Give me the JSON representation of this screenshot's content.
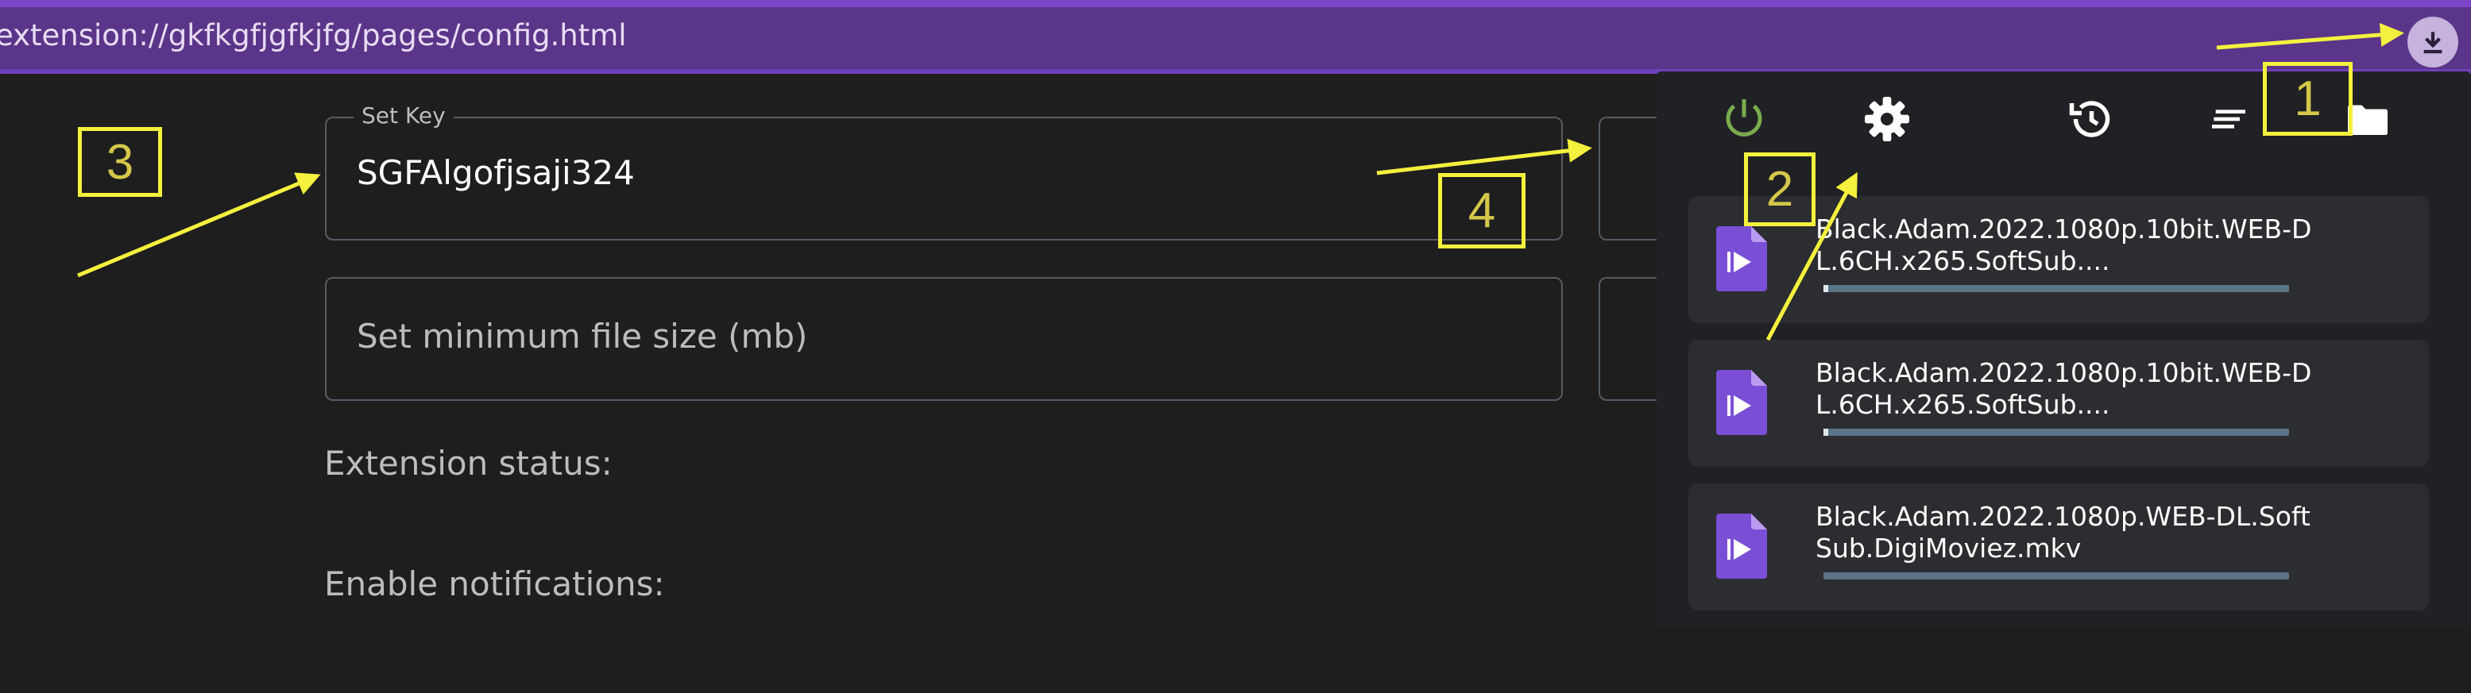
{
  "browser": {
    "url": "extension://gkfkgfjgfkjfg/pages/config.html",
    "download_icon": "download-icon"
  },
  "config": {
    "key_field": {
      "legend": "Set Key",
      "value": "SGFAlgofjsaji324"
    },
    "min_size_field": {
      "placeholder": "Set minimum file size (mb)"
    },
    "status_label": "Extension status:",
    "notifications_label": "Enable notifications:"
  },
  "popup": {
    "icons": [
      "power-icon",
      "gear-icon",
      "history-icon",
      "sort-icon",
      "folder-icon"
    ],
    "downloads": [
      {
        "name": "Black.Adam.2022.1080p.10bit.WEB-DL.6CH.x265.SoftSub....",
        "progress": 0.01
      },
      {
        "name": "Black.Adam.2022.1080p.10bit.WEB-DL.6CH.x265.SoftSub....",
        "progress": 0.01
      },
      {
        "name": "Black.Adam.2022.1080p.WEB-DL.SoftSub.DigiMoviez.mkv",
        "progress": 0.0
      }
    ]
  },
  "annotations": [
    "1",
    "2",
    "3",
    "4"
  ],
  "colors": {
    "accent": "#5b3589",
    "annotation": "#f4f13e",
    "power_green": "#7cab4e",
    "file_icon": "#7a4fd6"
  }
}
